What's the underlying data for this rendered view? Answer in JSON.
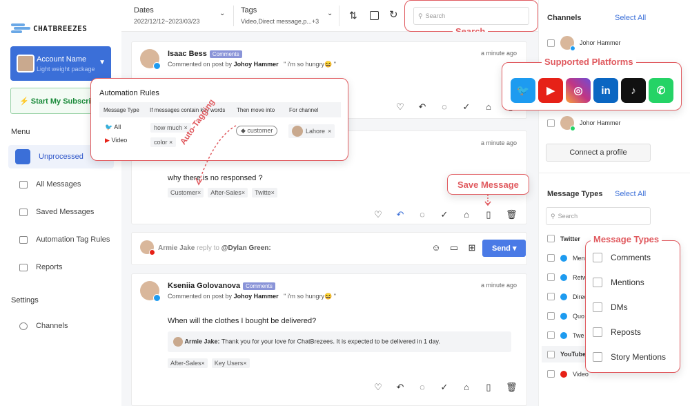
{
  "brand": {
    "logo_text": "CHATBREEZES"
  },
  "account": {
    "name": "Account Name",
    "package": "Light weight package"
  },
  "subscribe": {
    "label": "⚡ Start My Subscription"
  },
  "sidebar": {
    "menu_title": "Menu",
    "items": [
      {
        "label": "Unprocessed"
      },
      {
        "label": "All Messages"
      },
      {
        "label": "Saved Messages"
      },
      {
        "label": "Automation Tag Rules"
      },
      {
        "label": "Reports"
      }
    ],
    "settings_title": "Settings",
    "settings_items": [
      {
        "label": "Channels"
      }
    ]
  },
  "topbar": {
    "dates_label": "Dates",
    "dates_value": "2022/12/12~2023/03/23",
    "tags_label": "Tags",
    "tags_value": "Video,Direct message,p...+3",
    "search_placeholder": "Search"
  },
  "feed": {
    "card1": {
      "name": "Isaac Bess",
      "badge": "Comments",
      "meta_prefix": "Commented on post by",
      "meta_author": "Johoy Hammer",
      "meta_quote": "\" i'm so hungry😆 \"",
      "time": "a minute ago"
    },
    "card2": {
      "time": "a minute ago",
      "message": "why there is no responsed ?",
      "tags": [
        "Customer",
        "After-Sales",
        "Twitte"
      ]
    },
    "reply_bar": {
      "user": "Armie Jake",
      "reply_to": "reply to",
      "target": "@Dylan Green:",
      "send": "Send"
    },
    "card3": {
      "name": "Kseniia Golovanova",
      "badge": "Comments",
      "meta_prefix": "Commented on post by",
      "meta_author": "Johoy Hammer",
      "meta_quote": "\" i'm so hungry😆 \"",
      "time": "a minute ago",
      "message": "When will the clothes I bought be delivered?",
      "reply_user": "Armie Jake:",
      "reply_text": "Thank you for your love for ChatBrezees. It is expected to be delivered in 1 day.",
      "tags": [
        "After-Sales",
        "Key Users"
      ]
    }
  },
  "right": {
    "channels_title": "Channels",
    "select_all": "Select All",
    "profiles": [
      "Johor Hammer",
      "Johor Hammer"
    ],
    "connect": "Connect a profile",
    "types_title": "Message Types",
    "search_placeholder": "Search",
    "twitter": "Twitter",
    "twitter_items": [
      "Men",
      "Retw",
      "Direc",
      "Quo",
      "Twe"
    ],
    "youtube": "YouTube",
    "youtube_items": [
      "Video"
    ]
  },
  "callouts": {
    "search": "Search",
    "platforms": "Supported Platforms",
    "save_message": "Save Message",
    "auto_tagging": "Auto-Tagging",
    "message_types": "Message Types"
  },
  "automation": {
    "title": "Automation Rules",
    "headers": [
      "Message Type",
      "If messages contain key words",
      "Then move into",
      "For channel"
    ],
    "types": [
      "All",
      "Video"
    ],
    "keywords": [
      "how much",
      "color"
    ],
    "move_into": "customer",
    "channel": "Lahore"
  },
  "platforms": [
    {
      "name": "twitter",
      "color": "#1d9bf0"
    },
    {
      "name": "youtube",
      "color": "#e62117"
    },
    {
      "name": "instagram",
      "color": "#c13584"
    },
    {
      "name": "linkedin",
      "color": "#0a66c2"
    },
    {
      "name": "tiktok",
      "color": "#111111"
    },
    {
      "name": "whatsapp",
      "color": "#25d366"
    }
  ],
  "message_types_panel": [
    "Comments",
    "Mentions",
    "DMs",
    "Reposts",
    "Story Mentions"
  ]
}
